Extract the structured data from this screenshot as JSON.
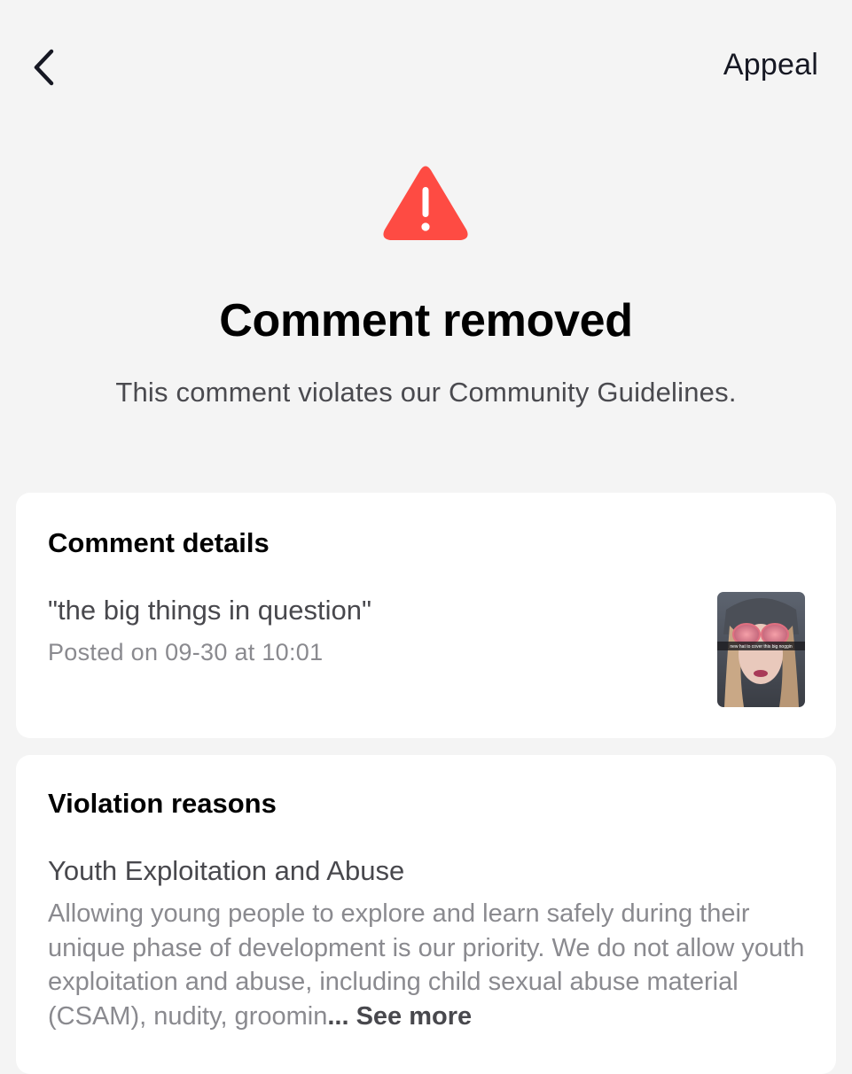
{
  "header": {
    "back_icon": "chevron-left-icon",
    "appeal_label": "Appeal"
  },
  "status": {
    "icon": "warning-triangle-icon",
    "icon_color": "#fe4b43",
    "title": "Comment removed",
    "subtitle": "This comment violates our Community Guidelines."
  },
  "comment_details": {
    "heading": "Comment details",
    "comment": "\"the big things in question\"",
    "posted": "Posted on 09-30 at 10:01",
    "thumbnail_caption": "new hat to cover this big noggin"
  },
  "violation": {
    "heading": "Violation reasons",
    "reason_title": "Youth Exploitation and Abuse",
    "reason_text": "Allowing young people to explore and learn safely during their unique phase of development is our priority. We do not allow youth exploitation and abuse, including child sexual abuse material (CSAM), nudity, groomin",
    "ellipsis": "...",
    "see_more_label": "See more"
  }
}
